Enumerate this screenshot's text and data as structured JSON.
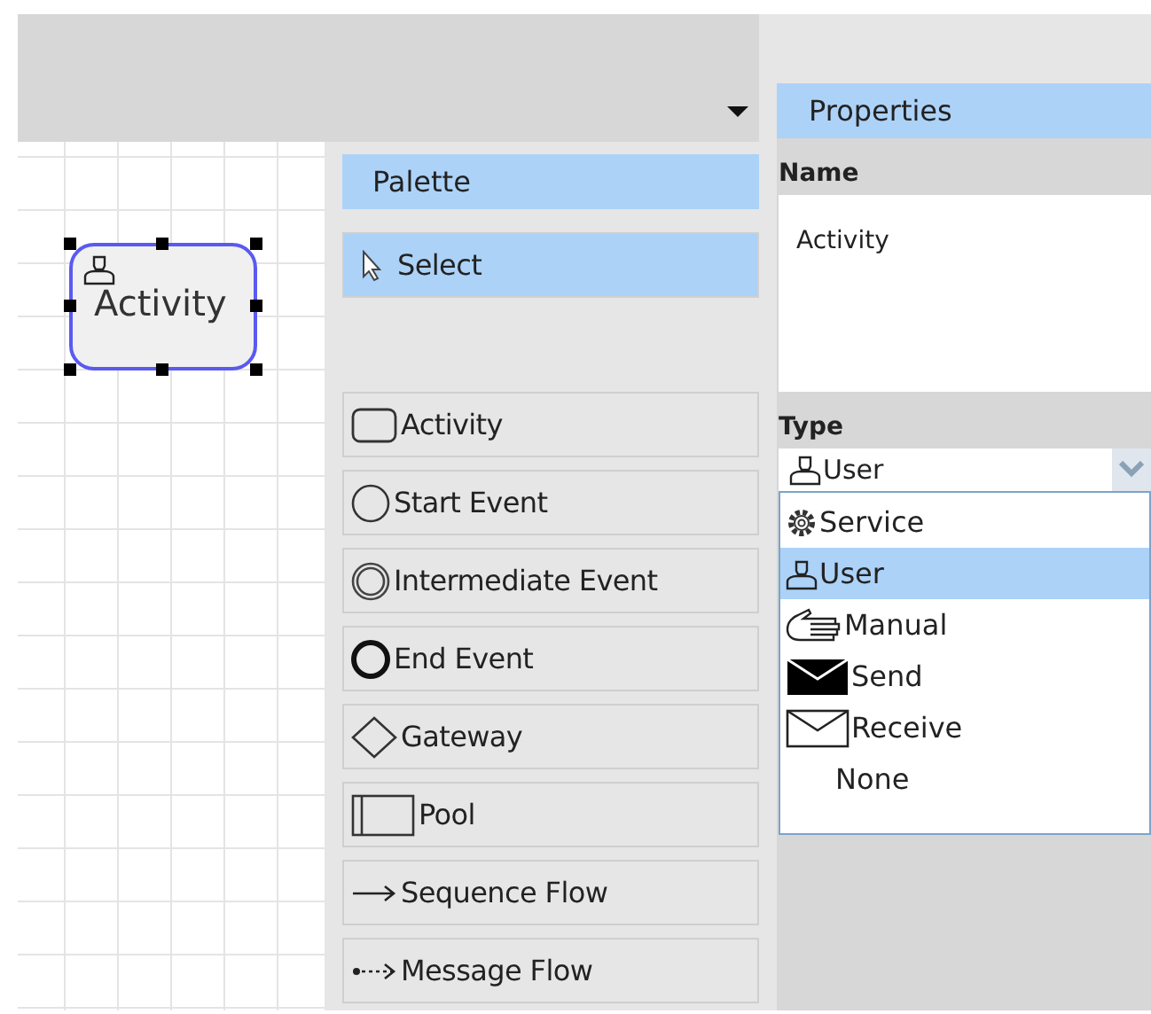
{
  "canvas": {
    "node": {
      "label": "Activity",
      "kind": "user",
      "selected": true
    }
  },
  "palette": {
    "title": "Palette",
    "items": [
      {
        "label": "Select",
        "kind": "select",
        "selected": true
      },
      {
        "label": "Activity",
        "kind": "activity",
        "selected": false
      },
      {
        "label": "Start Event",
        "kind": "start",
        "selected": false
      },
      {
        "label": "Intermediate Event",
        "kind": "intermediate",
        "selected": false
      },
      {
        "label": "End Event",
        "kind": "end",
        "selected": false
      },
      {
        "label": "Gateway",
        "kind": "gateway",
        "selected": false
      },
      {
        "label": "Pool",
        "kind": "pool",
        "selected": false
      },
      {
        "label": "Sequence Flow",
        "kind": "sequence",
        "selected": false
      },
      {
        "label": "Message Flow",
        "kind": "message",
        "selected": false
      }
    ]
  },
  "properties": {
    "title": "Properties",
    "name_label": "Name",
    "name_value": "Activity",
    "type_label": "Type",
    "type": {
      "label": "User",
      "kind": "user",
      "expanded": true
    },
    "options": [
      {
        "label": "Service",
        "kind": "service",
        "selected": false
      },
      {
        "label": "User",
        "kind": "user",
        "selected": true
      },
      {
        "label": "Manual",
        "kind": "manual",
        "selected": false
      },
      {
        "label": "Send",
        "kind": "send",
        "selected": false
      },
      {
        "label": "Receive",
        "kind": "receive",
        "selected": false
      },
      {
        "label": "None",
        "kind": "none",
        "selected": false
      }
    ]
  }
}
